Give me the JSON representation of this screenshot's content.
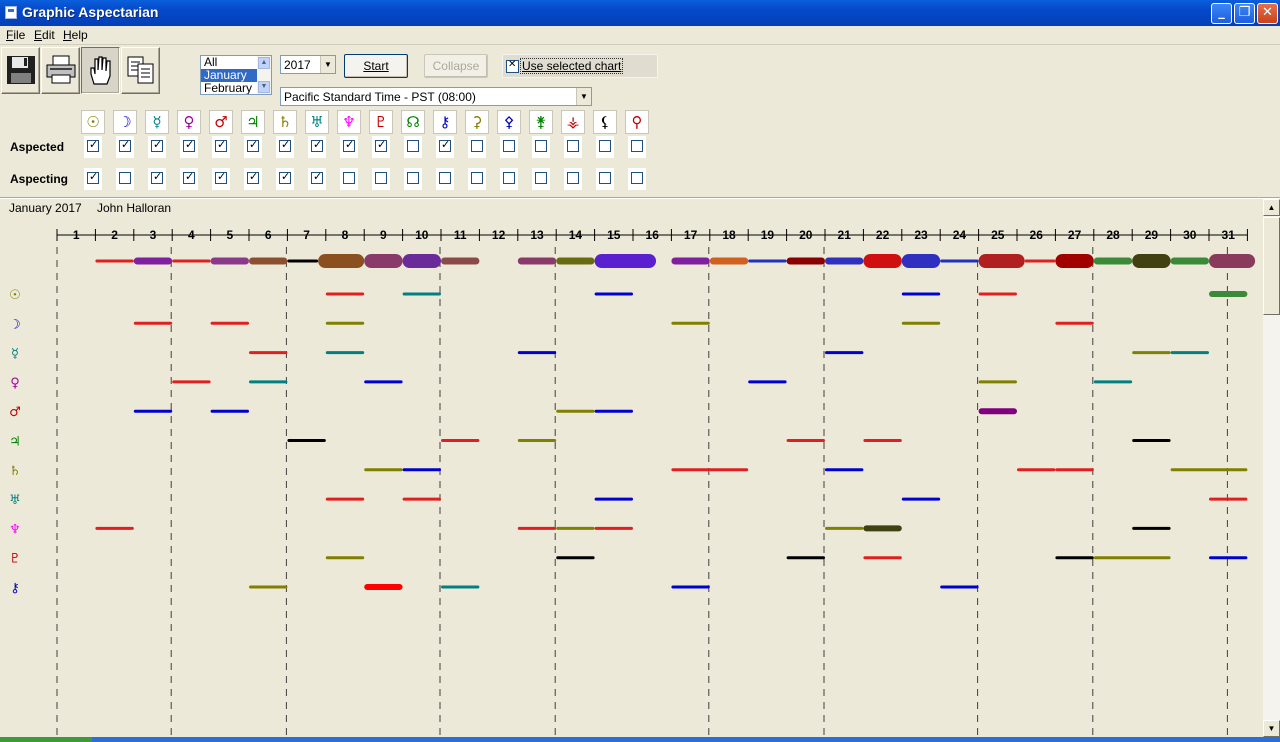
{
  "window": {
    "title": "Graphic Aspectarian"
  },
  "menu": [
    "File",
    "Edit",
    "Help"
  ],
  "toolbar": [
    {
      "name": "save-button",
      "icon": "floppy-icon"
    },
    {
      "name": "print-button",
      "icon": "printer-icon"
    },
    {
      "name": "hand-button",
      "icon": "hand-icon",
      "pressed": true
    },
    {
      "name": "copy-button",
      "icon": "copy-icon"
    }
  ],
  "month_list": {
    "options": [
      "All",
      "January",
      "February"
    ],
    "selected": "January"
  },
  "year": "2017",
  "timezone": "Pacific Standard Time - PST (08:00)",
  "buttons": {
    "start": "Start",
    "collapse": "Collapse"
  },
  "use_selected_chart": {
    "label": "Use selected chart",
    "checked": true
  },
  "planets": [
    {
      "glyph": "☉",
      "color": "#808000"
    },
    {
      "glyph": "☽",
      "color": "#0000c0"
    },
    {
      "glyph": "☿",
      "color": "#008080"
    },
    {
      "glyph": "♀",
      "color": "#a000a0"
    },
    {
      "glyph": "♂",
      "color": "#c00000"
    },
    {
      "glyph": "♃",
      "color": "#008000"
    },
    {
      "glyph": "♄",
      "color": "#808000"
    },
    {
      "glyph": "♅",
      "color": "#008080"
    },
    {
      "glyph": "♆",
      "color": "#ff00ff"
    },
    {
      "glyph": "♇",
      "color": "#c00000"
    },
    {
      "glyph": "☊",
      "color": "#008000"
    },
    {
      "glyph": "⚷",
      "color": "#0000c0"
    },
    {
      "glyph": "⚳",
      "color": "#808000"
    },
    {
      "glyph": "⚴",
      "color": "#0000c0"
    },
    {
      "glyph": "⚵",
      "color": "#008000"
    },
    {
      "glyph": "⚶",
      "color": "#c00000"
    },
    {
      "glyph": "⚸",
      "color": "#000000"
    },
    {
      "glyph": "⚲",
      "color": "#c00000"
    }
  ],
  "rows": {
    "aspected": {
      "label": "Aspected",
      "checks": [
        true,
        true,
        true,
        true,
        true,
        true,
        true,
        true,
        true,
        true,
        false,
        true,
        false,
        false,
        false,
        false,
        false,
        false
      ]
    },
    "aspecting": {
      "label": "Aspecting",
      "checks": [
        true,
        false,
        true,
        true,
        true,
        true,
        true,
        true,
        false,
        false,
        false,
        false,
        false,
        false,
        false,
        false,
        false,
        false
      ]
    }
  },
  "graph": {
    "month_label": "January 2017",
    "person": "John Halloran",
    "days": [
      1,
      2,
      3,
      4,
      5,
      6,
      7,
      8,
      9,
      10,
      11,
      12,
      13,
      14,
      15,
      16,
      17,
      18,
      19,
      20,
      21,
      22,
      23,
      24,
      25,
      26,
      27,
      28,
      29,
      30,
      31
    ],
    "row_glyphs": [
      {
        "glyph": "☉",
        "color": "#808000"
      },
      {
        "glyph": "☽",
        "color": "#0000c0"
      },
      {
        "glyph": "☿",
        "color": "#008080"
      },
      {
        "glyph": "♀",
        "color": "#a000a0"
      },
      {
        "glyph": "♂",
        "color": "#c00000"
      },
      {
        "glyph": "♃",
        "color": "#008000"
      },
      {
        "glyph": "♄",
        "color": "#808000"
      },
      {
        "glyph": "♅",
        "color": "#008080"
      },
      {
        "glyph": "♆",
        "color": "#ff00ff"
      },
      {
        "glyph": "♇",
        "color": "#c00000"
      },
      {
        "glyph": "⚷",
        "color": "#0000c0"
      }
    ],
    "summary_bar": [
      [
        2.0,
        3.0,
        "#e02020",
        "thin"
      ],
      [
        3.0,
        4.0,
        "#8020a0",
        "mid"
      ],
      [
        4.0,
        5.0,
        "#e02020",
        "thin"
      ],
      [
        5.0,
        6.0,
        "#8a3a8a",
        "mid"
      ],
      [
        6.0,
        7.0,
        "#8a5030",
        "mid"
      ],
      [
        7.0,
        7.8,
        "#000000",
        "thin"
      ],
      [
        7.8,
        9.0,
        "#8a5020",
        "thick"
      ],
      [
        9.0,
        10.0,
        "#8a3a6a",
        "thick"
      ],
      [
        10.0,
        11.0,
        "#6a2a9a",
        "thick"
      ],
      [
        11.0,
        12.0,
        "#8a4a4a",
        "mid"
      ],
      [
        13.0,
        14.0,
        "#8a3a6a",
        "mid"
      ],
      [
        14.0,
        15.0,
        "#6a6a10",
        "mid"
      ],
      [
        15.0,
        16.6,
        "#5a20d0",
        "thick"
      ],
      [
        17.0,
        18.0,
        "#8020a0",
        "mid"
      ],
      [
        18.0,
        19.0,
        "#d06020",
        "mid"
      ],
      [
        19.0,
        20.0,
        "#2030c0",
        "thin"
      ],
      [
        20.0,
        21.0,
        "#8a0000",
        "mid"
      ],
      [
        21.0,
        22.0,
        "#3030c0",
        "mid"
      ],
      [
        22.0,
        23.0,
        "#d01010",
        "thick"
      ],
      [
        23.0,
        24.0,
        "#3030c0",
        "thick"
      ],
      [
        24.0,
        25.0,
        "#2030c0",
        "thin"
      ],
      [
        25.0,
        26.2,
        "#b02020",
        "thick"
      ],
      [
        26.2,
        27.0,
        "#e02020",
        "thin"
      ],
      [
        27.0,
        28.0,
        "#a00000",
        "thick"
      ],
      [
        28.0,
        29.0,
        "#3a8a3a",
        "mid"
      ],
      [
        29.0,
        30.0,
        "#404010",
        "thick"
      ],
      [
        30.0,
        31.0,
        "#3a8a3a",
        "mid"
      ],
      [
        31.0,
        32.2,
        "#8a3a5a",
        "thick"
      ]
    ],
    "aspect_bars": [
      [
        0,
        8,
        9,
        "#e02020"
      ],
      [
        0,
        10,
        11,
        "#008080"
      ],
      [
        0,
        15,
        16,
        "#0000d0"
      ],
      [
        0,
        23,
        24,
        "#0000d0"
      ],
      [
        0,
        25,
        26,
        "#e02020"
      ],
      [
        0,
        31,
        32,
        "#3a8a3a"
      ],
      [
        1,
        3,
        4,
        "#e02020"
      ],
      [
        1,
        5,
        6,
        "#e02020"
      ],
      [
        1,
        8,
        9,
        "#808000"
      ],
      [
        1,
        17,
        18,
        "#808000"
      ],
      [
        1,
        23,
        24,
        "#808000"
      ],
      [
        1,
        27,
        28,
        "#e02020"
      ],
      [
        2,
        6,
        7,
        "#e02020"
      ],
      [
        2,
        8,
        9,
        "#008080"
      ],
      [
        2,
        13,
        14,
        "#0000d0"
      ],
      [
        2,
        21,
        22,
        "#0000d0"
      ],
      [
        2,
        29,
        30,
        "#808000"
      ],
      [
        2,
        30,
        31,
        "#008080"
      ],
      [
        3,
        4,
        5,
        "#e02020"
      ],
      [
        3,
        6,
        7,
        "#008080"
      ],
      [
        3,
        9,
        10,
        "#0000d0"
      ],
      [
        3,
        19,
        20,
        "#0000d0"
      ],
      [
        3,
        25,
        26,
        "#808000"
      ],
      [
        3,
        28,
        29,
        "#008080"
      ],
      [
        4,
        3,
        4,
        "#0000d0"
      ],
      [
        4,
        5,
        6,
        "#0000d0"
      ],
      [
        4,
        14,
        15,
        "#808000"
      ],
      [
        4,
        15,
        16,
        "#0000d0"
      ],
      [
        4,
        25,
        26,
        "#800080"
      ],
      [
        5,
        7,
        8,
        "#000000"
      ],
      [
        5,
        11,
        12,
        "#e02020"
      ],
      [
        5,
        13,
        14,
        "#808000"
      ],
      [
        5,
        20,
        21,
        "#e02020"
      ],
      [
        5,
        22,
        23,
        "#e02020"
      ],
      [
        5,
        29,
        30,
        "#000000"
      ],
      [
        6,
        9,
        10,
        "#808000"
      ],
      [
        6,
        10,
        11,
        "#0000d0"
      ],
      [
        6,
        17,
        19,
        "#e02020"
      ],
      [
        6,
        21,
        22,
        "#0000d0"
      ],
      [
        6,
        26,
        27,
        "#e02020"
      ],
      [
        6,
        27,
        28,
        "#e02020"
      ],
      [
        6,
        30,
        32,
        "#808000"
      ],
      [
        7,
        8,
        9,
        "#e02020"
      ],
      [
        7,
        10,
        11,
        "#e02020"
      ],
      [
        7,
        15,
        16,
        "#0000d0"
      ],
      [
        7,
        23,
        24,
        "#0000d0"
      ],
      [
        7,
        31,
        32,
        "#e02020"
      ],
      [
        8,
        2,
        3,
        "#e02020"
      ],
      [
        8,
        13,
        14,
        "#e02020"
      ],
      [
        8,
        14,
        15,
        "#808000"
      ],
      [
        8,
        15,
        16,
        "#e02020"
      ],
      [
        8,
        21,
        22,
        "#808000"
      ],
      [
        8,
        22,
        23,
        "#404010"
      ],
      [
        8,
        29,
        30,
        "#000000"
      ],
      [
        9,
        8,
        9,
        "#808000"
      ],
      [
        9,
        14,
        15,
        "#000000"
      ],
      [
        9,
        20,
        21,
        "#000000"
      ],
      [
        9,
        22,
        23,
        "#e02020"
      ],
      [
        9,
        27,
        28,
        "#000000"
      ],
      [
        9,
        28,
        30,
        "#808000"
      ],
      [
        9,
        31,
        32,
        "#0000d0"
      ],
      [
        10,
        6,
        7,
        "#808000"
      ],
      [
        10,
        9,
        10,
        "#ff0000"
      ],
      [
        10,
        11,
        12,
        "#008080"
      ],
      [
        10,
        17,
        18,
        "#0000d0"
      ],
      [
        10,
        24,
        25,
        "#0000d0"
      ]
    ]
  }
}
